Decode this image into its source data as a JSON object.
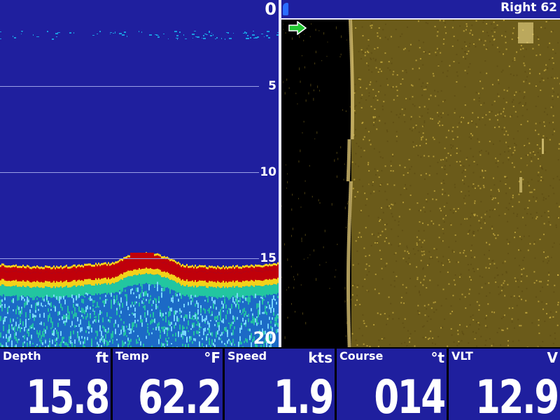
{
  "sonar": {
    "depth_scale": [
      {
        "label": "0",
        "value": 0
      },
      {
        "label": "5",
        "value": 5
      },
      {
        "label": "10",
        "value": 10
      },
      {
        "label": "15",
        "value": 15
      },
      {
        "label": "20",
        "value": 20
      }
    ],
    "bottom_depth_ft": 15.8,
    "colors": {
      "background": "#1f1f9e",
      "strong_return": "#c0000a",
      "medium_return": "#f2d21a",
      "weak_return": "#22c6a0",
      "faint_return": "#1aa8e8"
    }
  },
  "side_imaging": {
    "title": "Right 62",
    "color": "#c2a530",
    "icons": [
      "boat-marker-icon",
      "forward-arrow-icon"
    ]
  },
  "data_bar": [
    {
      "label": "Depth",
      "unit": "ft",
      "value": "15.8"
    },
    {
      "label": "Temp",
      "unit": "°F",
      "value": "62.2"
    },
    {
      "label": "Speed",
      "unit": "kts",
      "value": "1.9"
    },
    {
      "label": "Course",
      "unit": "°t",
      "value": "014"
    },
    {
      "label": "VLT",
      "unit": "V",
      "value": "12.9"
    }
  ]
}
